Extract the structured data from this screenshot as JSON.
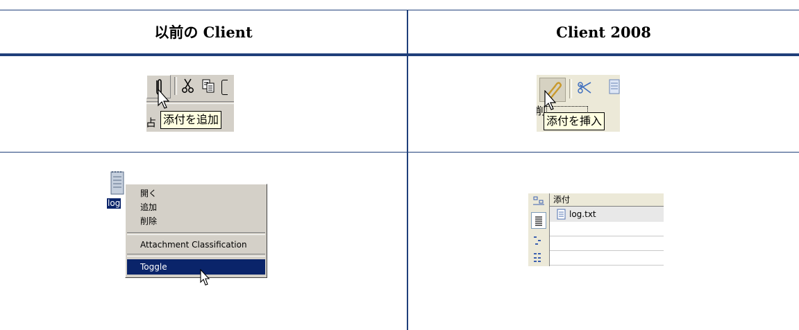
{
  "table": {
    "col_old_header": "以前の Client",
    "col_new_header": "Client 2008"
  },
  "old_toolbar": {
    "tooltip": "添付を追加",
    "icons": [
      "paperclip-icon",
      "scissors-icon",
      "copy-icon"
    ],
    "partial_label": "占"
  },
  "new_toolbar": {
    "tooltip": "添付を挿入",
    "icons": [
      "paperclip-icon",
      "scissors-icon",
      "notepad-icon"
    ],
    "partial_label": "削"
  },
  "old_context_menu": {
    "file_label": "log",
    "items": [
      "開く",
      "追加",
      "削除",
      "Attachment Classification",
      "Toggle"
    ],
    "selected_item": "Toggle",
    "icons": [
      "notepad-icon",
      "mouse-cursor-icon"
    ]
  },
  "new_attachments_pane": {
    "column_header": "添付",
    "rows": [
      "log.txt"
    ],
    "icons": [
      "sort-icon",
      "list-view-icon",
      "tree-view-icon",
      "hierarchy-icon",
      "text-file-icon"
    ]
  },
  "colors": {
    "rule": "#1f3f7a",
    "tooltip_bg": "#ffffe1",
    "menu_selection": "#0a246a"
  }
}
